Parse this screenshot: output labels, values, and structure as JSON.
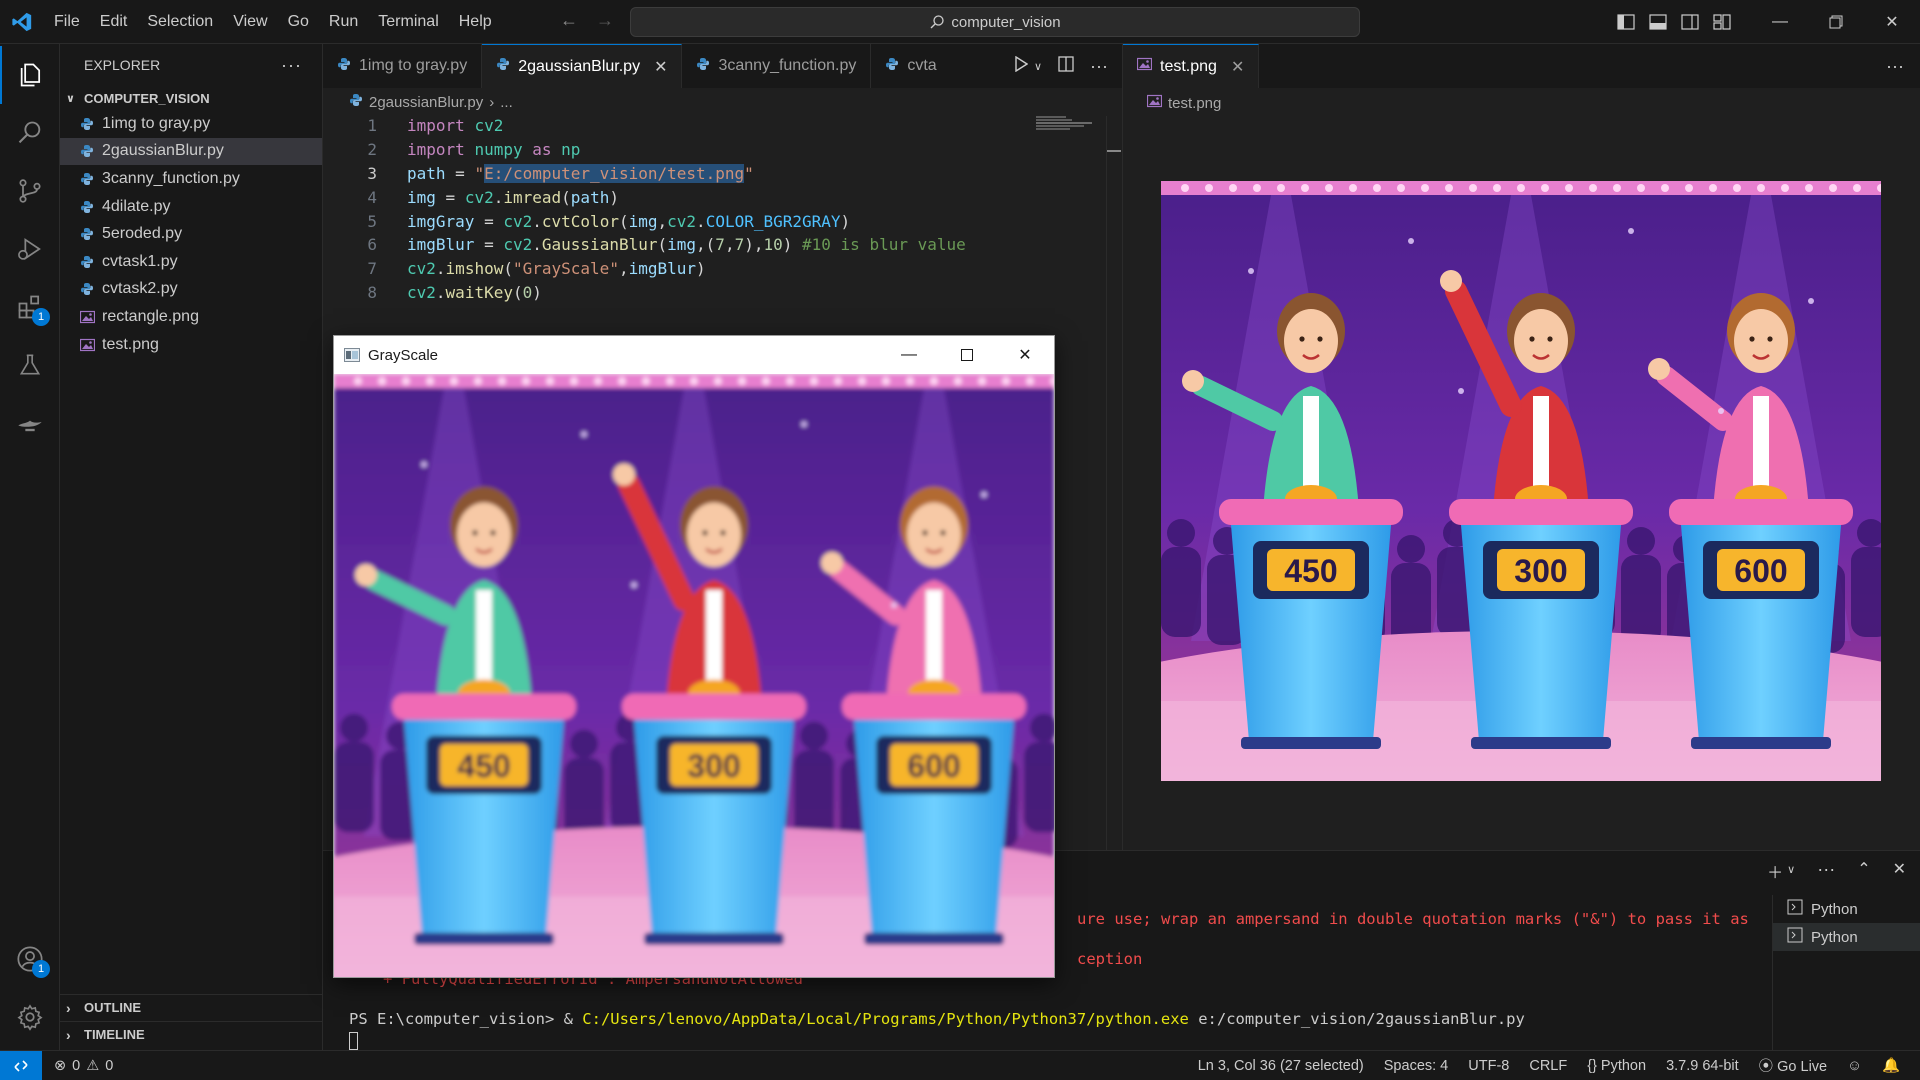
{
  "titlebar": {
    "menu": [
      "File",
      "Edit",
      "Selection",
      "View",
      "Go",
      "Run",
      "Terminal",
      "Help"
    ],
    "search": "computer_vision"
  },
  "activity_badges": {
    "extensions": "1",
    "accounts": "1"
  },
  "explorer": {
    "header": "EXPLORER",
    "folder": "COMPUTER_VISION",
    "files": [
      {
        "name": "1img to gray.py",
        "type": "py"
      },
      {
        "name": "2gaussianBlur.py",
        "type": "py",
        "selected": true
      },
      {
        "name": "3canny_function.py",
        "type": "py"
      },
      {
        "name": "4dilate.py",
        "type": "py"
      },
      {
        "name": "5eroded.py",
        "type": "py"
      },
      {
        "name": "cvtask1.py",
        "type": "py"
      },
      {
        "name": "cvtask2.py",
        "type": "py"
      },
      {
        "name": "rectangle.png",
        "type": "png"
      },
      {
        "name": "test.png",
        "type": "png"
      }
    ],
    "outline": "OUTLINE",
    "timeline": "TIMELINE"
  },
  "editor": {
    "tabs": [
      "1img to gray.py",
      "2gaussianBlur.py",
      "3canny_function.py",
      "cvta"
    ],
    "active_tab": "2gaussianBlur.py",
    "breadcrumb_file": "2gaussianBlur.py",
    "breadcrumb_more": "...",
    "lines": [
      {
        "n": "1",
        "code": "import cv2"
      },
      {
        "n": "2",
        "code": "import numpy as np"
      },
      {
        "n": "3",
        "code": "path = \"E:/computer_vision/test.png\""
      },
      {
        "n": "4",
        "code": "img = cv2.imread(path)"
      },
      {
        "n": "5",
        "code": "imgGray = cv2.cvtColor(img,cv2.COLOR_BGR2GRAY)"
      },
      {
        "n": "6",
        "code": "imgBlur = cv2.GaussianBlur(img,(7,7),10) #10 is blur value"
      },
      {
        "n": "7",
        "code": "cv2.imshow(\"GrayScale\",imgBlur)"
      },
      {
        "n": "8",
        "code": "cv2.waitKey(0)"
      }
    ]
  },
  "preview": {
    "tab": "test.png",
    "breadcrumb": "test.png",
    "scores": [
      "450",
      "300",
      "600"
    ]
  },
  "gray_window": {
    "title": "GrayScale",
    "scores": [
      "450",
      "300",
      "600"
    ]
  },
  "terminal": {
    "err1": "ure use; wrap an ampersand in double quotation marks (\"&\") to pass it as",
    "err2": "ception",
    "err3": "+ FullyQualifiedErrorId : AmpersandNotAllowed",
    "prompt": "PS E:\\computer_vision> & ",
    "exe": "C:/Users/lenovo/AppData/Local/Programs/Python/Python37/python.exe",
    "arg": " e:/computer_vision/2gaussianBlur.py",
    "instances": [
      "Python",
      "Python"
    ]
  },
  "status": {
    "errors": "0",
    "warnings": "0",
    "position": "Ln 3, Col 36 (27 selected)",
    "spaces": "Spaces: 4",
    "encoding": "UTF-8",
    "eol": "CRLF",
    "language": "Python",
    "interpreter": "3.7.9 64-bit",
    "golive": "Go Live"
  },
  "colors": {
    "accent": "#0078d4",
    "keyword": "#c586c0",
    "string": "#ce9178",
    "comment": "#6a9955",
    "number": "#b5cea8",
    "error": "#f14c4c",
    "exe_path": "#e5e510"
  }
}
